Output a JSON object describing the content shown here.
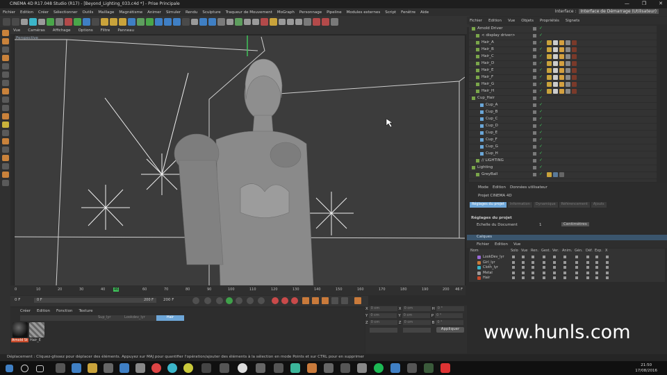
{
  "window": {
    "title": "CINEMA 4D R17.048 Studio (R17) - [Beyond_Lighting_033.c4d *] - Prise Principale",
    "controls": [
      "—",
      "❐",
      "✕"
    ]
  },
  "menubar": {
    "items": [
      "Fichier",
      "Edition",
      "Créer",
      "Sélectionner",
      "Outils",
      "Maillage",
      "Magnétisme",
      "Animer",
      "Simuler",
      "Rendu",
      "Sculpture",
      "Traqueur de Mouvement",
      "MoGraph",
      "Personnage",
      "Pipeline",
      "Modules externes",
      "Script",
      "Fenêtre",
      "Aide"
    ],
    "interface_label": "Interface :",
    "interface_value": "Interface de Démarrage (Utilisateur)"
  },
  "viewport": {
    "menu": [
      "Vue",
      "Caméras",
      "Affichage",
      "Options",
      "Filtre",
      "Panneau"
    ],
    "label": "Perspective"
  },
  "timeline": {
    "ticks": [
      "0",
      "10",
      "20",
      "30",
      "40",
      "50",
      "60",
      "70",
      "80",
      "90",
      "100",
      "110",
      "120",
      "130",
      "140",
      "150",
      "160",
      "170",
      "180",
      "190",
      "200"
    ],
    "current_frame": "46",
    "end_label": "46 F",
    "start_field": "0 F",
    "range_start": "0 F",
    "range_end": "200 F",
    "end_field": "200 F"
  },
  "materials": {
    "menu": [
      "Créer",
      "Edition",
      "Fonction",
      "Texture"
    ],
    "tabs": [
      "",
      "",
      "Sup_lyr",
      "Lookdev_lyr"
    ],
    "active_tab": "Hair",
    "items": [
      {
        "name": "Arnold St",
        "color": "#c94a2a"
      },
      {
        "name": "Hair_E",
        "color": "#8a8a8a"
      }
    ]
  },
  "coordinates": {
    "rows": [
      {
        "a": "X",
        "av": "0 cm",
        "b": "X",
        "bv": "0 cm",
        "c": "H",
        "cv": "0 °"
      },
      {
        "a": "Y",
        "av": "0 cm",
        "b": "Y",
        "bv": "0 cm",
        "c": "P",
        "cv": "0 °"
      },
      {
        "a": "Z",
        "av": "0 cm",
        "b": "Z",
        "bv": "0 cm",
        "c": "B",
        "cv": "0 °"
      }
    ],
    "apply": "Appliquer"
  },
  "objects": {
    "menu": [
      "Fichier",
      "Edition",
      "Vue",
      "Objets",
      "Propriétés",
      "Signets"
    ],
    "rows": [
      {
        "name": "Arnold Driver",
        "indent": 0,
        "tags": []
      },
      {
        "name": "< display driver>",
        "indent": 1,
        "tags": []
      },
      {
        "name": "Hair_A",
        "indent": 1,
        "tags": [
          "#c9a33b",
          "#cccccc",
          "#d4a040",
          "#888888",
          "#7a3a2a"
        ]
      },
      {
        "name": "Hair_B",
        "indent": 1,
        "tags": [
          "#c9a33b",
          "#cccccc",
          "#d4a040",
          "#888888",
          "#7a3a2a"
        ]
      },
      {
        "name": "Hair_C",
        "indent": 1,
        "tags": [
          "#c9a33b",
          "#cccccc",
          "#d4a040",
          "#888888",
          "#7a3a2a"
        ]
      },
      {
        "name": "Hair_D",
        "indent": 1,
        "tags": [
          "#c9a33b",
          "#cccccc",
          "#d4a040",
          "#888888",
          "#7a3a2a"
        ]
      },
      {
        "name": "Hair_E",
        "indent": 1,
        "tags": [
          "#c9a33b",
          "#cccccc",
          "#d4a040",
          "#888888",
          "#7a3a2a"
        ]
      },
      {
        "name": "Hair_F",
        "indent": 1,
        "tags": [
          "#c9a33b",
          "#cccccc",
          "#d4a040",
          "#888888",
          "#7a3a2a"
        ]
      },
      {
        "name": "Hair_G",
        "indent": 1,
        "tags": [
          "#c9a33b",
          "#cccccc",
          "#d4a040",
          "#888888",
          "#7a3a2a"
        ]
      },
      {
        "name": "Hair_H",
        "indent": 1,
        "tags": [
          "#c9a33b",
          "#cccccc",
          "#d4a040",
          "#888888",
          "#7a3a2a"
        ]
      },
      {
        "name": "Cup_Hair",
        "indent": 0,
        "tags": []
      },
      {
        "name": "Cup_A",
        "indent": 2,
        "tags": []
      },
      {
        "name": "Cup_B",
        "indent": 2,
        "tags": []
      },
      {
        "name": "Cup_C",
        "indent": 2,
        "tags": []
      },
      {
        "name": "Cup_D",
        "indent": 2,
        "tags": []
      },
      {
        "name": "Cup_E",
        "indent": 2,
        "tags": []
      },
      {
        "name": "Cup_F",
        "indent": 2,
        "tags": []
      },
      {
        "name": "Cup_G",
        "indent": 2,
        "tags": []
      },
      {
        "name": "Cup_H",
        "indent": 2,
        "tags": []
      },
      {
        "name": "// LIGHTING",
        "indent": 1,
        "tags": []
      },
      {
        "name": "Lighting",
        "indent": 0,
        "tags": []
      },
      {
        "name": "GreyBall",
        "indent": 1,
        "tags": [
          "#c9a33b",
          "#5a7a9a",
          "#666666"
        ]
      }
    ]
  },
  "attributes": {
    "menu": [
      "Mode",
      "Edition",
      "Données utilisateur"
    ],
    "project": "Projet CINEMA 4D",
    "tabs": [
      "Réglages du projet",
      "Information",
      "Dynamique",
      "Référencement",
      "Ajouts"
    ],
    "active_tab": "Réglages du projet",
    "section": "Réglages du projet",
    "doc_label": "Echelle du Document",
    "doc_value": "1",
    "doc_unit": "Centimètres"
  },
  "layers": {
    "title": "Calques",
    "menu": [
      "Fichier",
      "Edition",
      "Vue"
    ],
    "headers": [
      "Nom",
      "Solo",
      "Vue",
      "Ren.",
      "Gest.",
      "Ver.",
      "Anim.",
      "Gén.",
      "Déf.",
      "Exp.",
      "X"
    ],
    "rows": [
      {
        "name": "LookDev_lyr",
        "color": "#9a6ad8"
      },
      {
        "name": "Girl_lyr",
        "color": "#c97a3b"
      },
      {
        "name": "Cloth_lyr",
        "color": "#3bb5c9"
      },
      {
        "name": "Metal",
        "color": "#9a9a9a"
      },
      {
        "name": "Hair",
        "color": "#c94a2a"
      }
    ]
  },
  "watermark": "www.hunls.com",
  "status": "Déplacement : Cliquez-glissez pour déplacer des éléments. Appuyez sur MAJ pour quantifier l'opération/ajouter des éléments à la sélection en mode Points et sur CTRL pour en supprimer",
  "taskbar": {
    "time": "21:50",
    "date": "17/08/2016"
  }
}
